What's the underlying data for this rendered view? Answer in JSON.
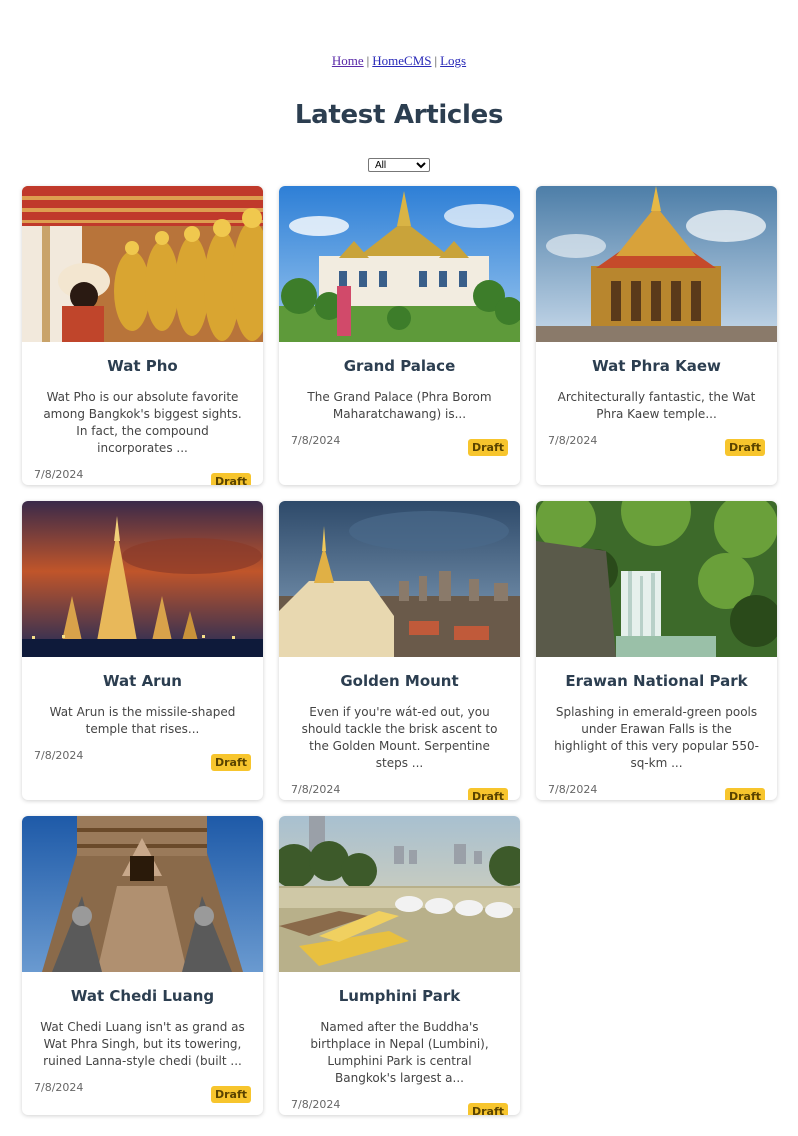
{
  "nav": {
    "links": [
      "Home",
      "HomeCMS",
      "Logs"
    ],
    "separator": "|"
  },
  "page_title": "Latest Articles",
  "filter": {
    "selected": "All",
    "options": [
      "All"
    ]
  },
  "articles": [
    {
      "title": "Wat Pho",
      "description": "Wat Pho is our absolute favorite among Bangkok's biggest sights. In fact, the compound incorporates ...",
      "date": "7/8/2024",
      "status": "Draft",
      "image": "reclining-buddha-statues"
    },
    {
      "title": "Grand Palace",
      "description": "The Grand Palace (Phra Borom Maharatchawang) is...",
      "date": "7/8/2024",
      "status": "Draft",
      "image": "grand-palace-building"
    },
    {
      "title": "Wat Phra Kaew",
      "description": "Architecturally fantastic, the Wat Phra Kaew temple...",
      "date": "7/8/2024",
      "status": "Draft",
      "image": "golden-temple"
    },
    {
      "title": "Wat Arun",
      "description": "Wat Arun is the missile-shaped temple that rises...",
      "date": "7/8/2024",
      "status": "Draft",
      "image": "temple-at-dusk"
    },
    {
      "title": "Golden Mount",
      "description": "Even if you're wát-ed out, you should tackle the brisk ascent to the Golden Mount. Serpentine steps ...",
      "date": "7/8/2024",
      "status": "Draft",
      "image": "hilltop-temple-city"
    },
    {
      "title": "Erawan National Park",
      "description": "Splashing in emerald-green pools under Erawan Falls is the highlight of this very popular 550-sq-km ...",
      "date": "7/8/2024",
      "status": "Draft",
      "image": "waterfall-forest"
    },
    {
      "title": "Wat Chedi Luang",
      "description": "Wat Chedi Luang isn't as grand as Wat Phra Singh, but its towering, ruined Lanna-style chedi (built ...",
      "date": "7/8/2024",
      "status": "Draft",
      "image": "ruined-chedi"
    },
    {
      "title": "Lumphini Park",
      "description": "Named after the Buddha's birthplace in Nepal (Lumbini), Lumphini Park is central Bangkok's largest a...",
      "date": "7/8/2024",
      "status": "Draft",
      "image": "park-lake-boats"
    }
  ],
  "colors": {
    "badge": "#f7c52d",
    "title": "#2c3e50",
    "link": "#2a2ab8"
  }
}
